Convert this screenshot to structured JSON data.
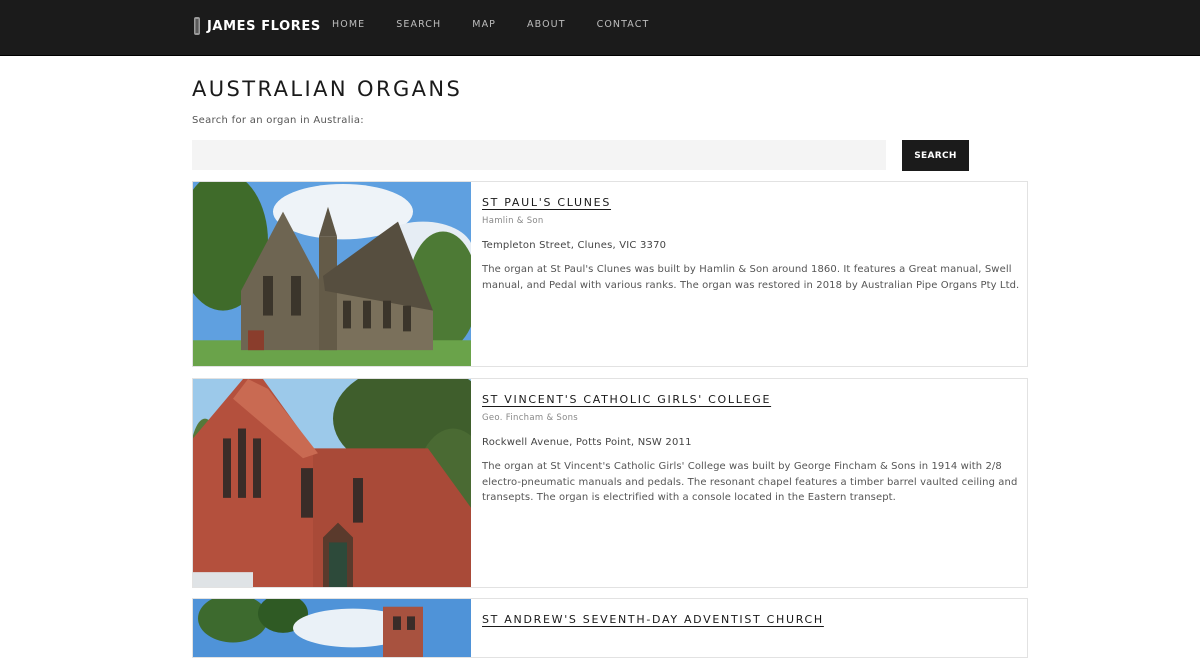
{
  "header": {
    "brand": "JAMES FLORES",
    "brand_icon": "organ-pipe-icon",
    "nav": [
      "HOME",
      "SEARCH",
      "MAP",
      "ABOUT",
      "CONTACT"
    ]
  },
  "main": {
    "title": "AUSTRALIAN ORGANS",
    "search_label": "Search for an organ in Australia:",
    "search_value": "",
    "search_placeholder": "",
    "search_button": "SEARCH"
  },
  "organs": [
    {
      "name": "ST PAUL'S CLUNES",
      "builder": "Hamlin & Son",
      "address": "Templeton Street, Clunes, VIC 3370",
      "description": "The organ at St Paul's Clunes was built by Hamlin & Son around 1860. It features a Great manual, Swell manual, and Pedal with various ranks. The organ was restored in 2018 by Australian Pipe Organs Pty Ltd."
    },
    {
      "name": "ST VINCENT'S CATHOLIC GIRLS' COLLEGE",
      "builder": "Geo. Fincham & Sons",
      "address": "Rockwell Avenue, Potts Point, NSW 2011",
      "description": "The organ at St Vincent's Catholic Girls' College was built by George Fincham & Sons in 1914 with 2/8 electro-pneumatic manuals and pedals. The resonant chapel features a timber barrel vaulted ceiling and transepts. The organ is electrified with a console located in the Eastern transept."
    },
    {
      "name": "ST ANDREW'S SEVENTH-DAY ADVENTIST CHURCH"
    }
  ],
  "colors": {
    "header_bg": "#1b1b1b",
    "button_bg": "#1b1b1b",
    "input_bg": "#f4f4f4"
  }
}
